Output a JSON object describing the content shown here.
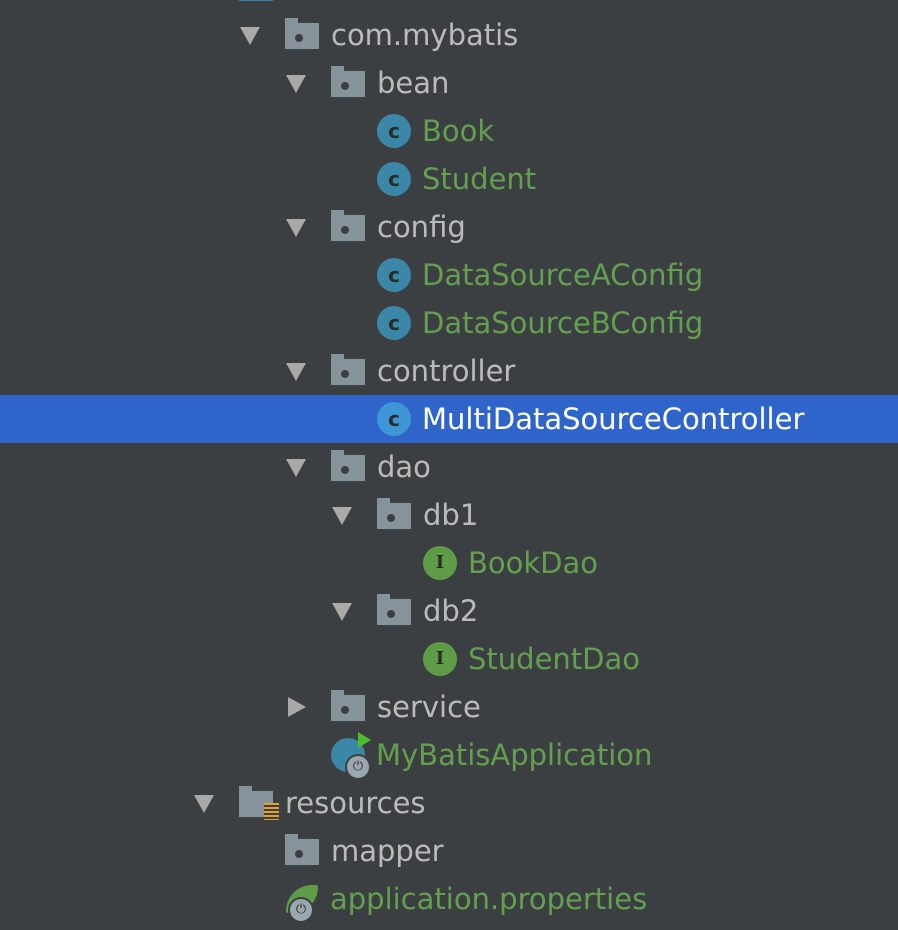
{
  "colors": {
    "background": "#3c3f41",
    "selection": "#2f65ca",
    "class_text": "#62a04f",
    "folder_text": "#bbbbbb"
  },
  "tree": [
    {
      "level": 0,
      "kind": "source-folder",
      "arrow": "down",
      "label": ""
    },
    {
      "level": 1,
      "kind": "package",
      "arrow": "down",
      "label": "com.mybatis"
    },
    {
      "level": 2,
      "kind": "package",
      "arrow": "down",
      "label": "bean"
    },
    {
      "level": 3,
      "kind": "class",
      "label": "Book"
    },
    {
      "level": 3,
      "kind": "class",
      "label": "Student"
    },
    {
      "level": 2,
      "kind": "package",
      "arrow": "down",
      "label": "config"
    },
    {
      "level": 3,
      "kind": "class",
      "label": "DataSourceAConfig"
    },
    {
      "level": 3,
      "kind": "class",
      "label": "DataSourceBConfig"
    },
    {
      "level": 2,
      "kind": "package",
      "arrow": "down",
      "label": "controller"
    },
    {
      "level": 3,
      "kind": "class",
      "label": "MultiDataSourceController",
      "selected": true
    },
    {
      "level": 2,
      "kind": "package",
      "arrow": "down",
      "label": "dao"
    },
    {
      "level": 3,
      "kind": "package",
      "arrow": "down",
      "label": "db1"
    },
    {
      "level": 4,
      "kind": "interface",
      "label": "BookDao"
    },
    {
      "level": 3,
      "kind": "package",
      "arrow": "down",
      "label": "db2"
    },
    {
      "level": 4,
      "kind": "interface",
      "label": "StudentDao"
    },
    {
      "level": 2,
      "kind": "package",
      "arrow": "right",
      "label": "service"
    },
    {
      "level": 2,
      "kind": "spring-app-class",
      "label": "MyBatisApplication"
    },
    {
      "level": 0,
      "kind": "resources-folder",
      "arrow": "down",
      "label": "resources"
    },
    {
      "level": 1,
      "kind": "package",
      "label": "mapper"
    },
    {
      "level": 1,
      "kind": "spring-properties",
      "label": "application.properties"
    }
  ],
  "icon_glyphs": {
    "class": "c",
    "interface": "I",
    "spring-badge": "⏻"
  }
}
